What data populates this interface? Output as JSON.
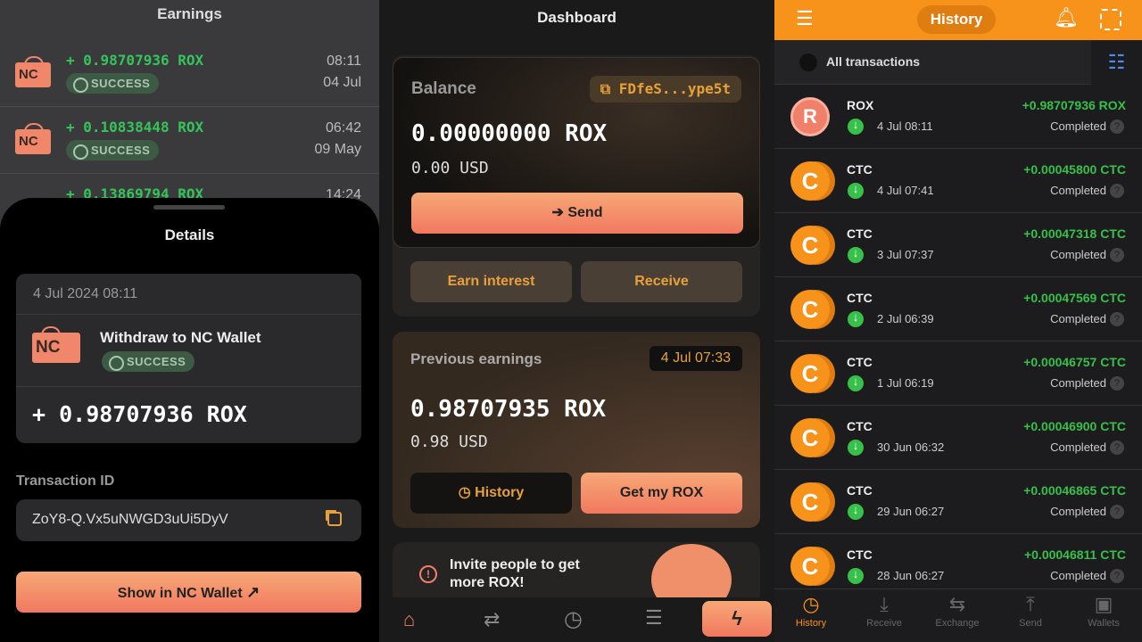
{
  "earnings": {
    "title": "Earnings",
    "items": [
      {
        "amount": "+ 0.98707936 ROX",
        "status": "SUCCESS",
        "time": "08:11",
        "date": "04 Jul"
      },
      {
        "amount": "+ 0.10838448 ROX",
        "status": "SUCCESS",
        "time": "06:42",
        "date": "09 May"
      },
      {
        "amount": "+ 0.13869794 ROX",
        "time": "14:24"
      }
    ]
  },
  "details": {
    "title": "Details",
    "date": "4 Jul 2024 08:11",
    "nc_logo": "NC",
    "description": "Withdraw to NC Wallet",
    "status": "SUCCESS",
    "amount": "+ 0.98707936 ROX",
    "txid_label": "Transaction ID",
    "txid": "ZoY8-Q.Vx5uNWGD3uUi5DyV",
    "show_button": "Show in NC Wallet"
  },
  "dashboard": {
    "title": "Dashboard",
    "balance_label": "Balance",
    "address": "FDfeS...ype5t",
    "balance": "0.00000000 ROX",
    "balance_usd": "0.00 USD",
    "send": "Send",
    "earn_interest": "Earn interest",
    "receive": "Receive",
    "prev_label": "Previous earnings",
    "prev_date": "4 Jul 07:33",
    "prev_amount": "0.98707935 ROX",
    "prev_usd": "0.98 USD",
    "history": "History",
    "get_rox": "Get my ROX",
    "invite": "Invite people to get more ROX!"
  },
  "history": {
    "title": "History",
    "filter": "All transactions",
    "accent": "#f7931a",
    "items": [
      {
        "coin": "ROX",
        "date": "4 Jul 08:11",
        "amount": "+0.98707936 ROX",
        "status": "Completed"
      },
      {
        "coin": "CTC",
        "date": "4 Jul 07:41",
        "amount": "+0.00045800 CTC",
        "status": "Completed"
      },
      {
        "coin": "CTC",
        "date": "3 Jul 07:37",
        "amount": "+0.00047318 CTC",
        "status": "Completed"
      },
      {
        "coin": "CTC",
        "date": "2 Jul 06:39",
        "amount": "+0.00047569 CTC",
        "status": "Completed"
      },
      {
        "coin": "CTC",
        "date": "1 Jul 06:19",
        "amount": "+0.00046757 CTC",
        "status": "Completed"
      },
      {
        "coin": "CTC",
        "date": "30 Jun 06:32",
        "amount": "+0.00046900 CTC",
        "status": "Completed"
      },
      {
        "coin": "CTC",
        "date": "29 Jun 06:27",
        "amount": "+0.00046865 CTC",
        "status": "Completed"
      },
      {
        "coin": "CTC",
        "date": "28 Jun 06:27",
        "amount": "+0.00046811 CTC",
        "status": "Completed"
      }
    ],
    "nav": [
      "History",
      "Receive",
      "Exchange",
      "Send",
      "Wallets"
    ]
  }
}
